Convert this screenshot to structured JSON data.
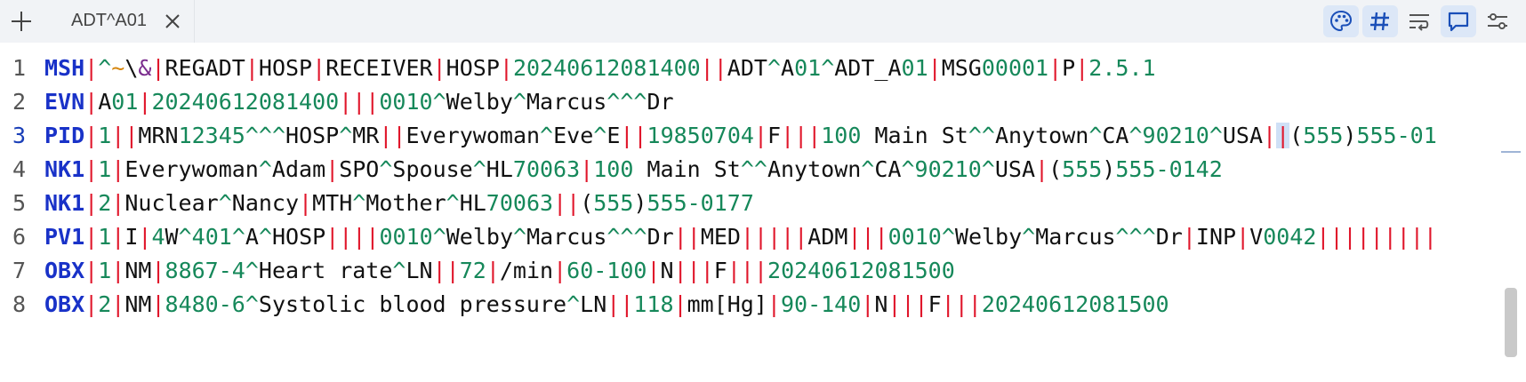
{
  "tabbar": {
    "add_icon": "plus-icon",
    "tab_title": "ADT^A01",
    "close_icon": "close-icon"
  },
  "toolbar": {
    "items": [
      {
        "icon": "palette-icon",
        "active": true
      },
      {
        "icon": "hash-icon",
        "active": true
      },
      {
        "icon": "wrap-icon",
        "active": false
      },
      {
        "icon": "comment-icon",
        "active": true
      },
      {
        "icon": "settings-sliders-icon",
        "active": false
      }
    ]
  },
  "editor": {
    "current_line": 3,
    "lines": [
      {
        "n": "1",
        "text": "MSH|^~\\&|REGADT|HOSP|RECEIVER|HOSP|20240612081400||ADT^A01^ADT_A01|MSG00001|P|2.5.1"
      },
      {
        "n": "2",
        "text": "EVN|A01|20240612081400|||0010^Welby^Marcus^^^Dr"
      },
      {
        "n": "3",
        "text": "PID|1||MRN12345^^^HOSP^MR||Everywoman^Eve^E||19850704|F|||100 Main St^^Anytown^CA^90210^USA||(555)555-01"
      },
      {
        "n": "4",
        "text": "NK1|1|Everywoman^Adam|SPO^Spouse^HL70063|100 Main St^^Anytown^CA^90210^USA|(555)555-0142"
      },
      {
        "n": "5",
        "text": "NK1|2|Nuclear^Nancy|MTH^Mother^HL70063||(555)555-0177"
      },
      {
        "n": "6",
        "text": "PV1|1|I|4W^401^A^HOSP||||0010^Welby^Marcus^^^Dr||MED|||||ADM|||0010^Welby^Marcus^^^Dr|INP|V0042|||||||||"
      },
      {
        "n": "7",
        "text": "OBX|1|NM|8867-4^Heart rate^LN||72|/min|60-100|N|||F|||20240612081500"
      },
      {
        "n": "8",
        "text": "OBX|2|NM|8480-6^Systolic blood pressure^LN||118|mm[Hg]|90-140|N|||F|||20240612081500"
      }
    ]
  },
  "colors": {
    "segment": "#1932c8",
    "field_separator": "#e0162b",
    "component_separator": "#16885a",
    "numeric": "#16885a",
    "escape": "#7b2d8e",
    "subcomponent": "#d6860c",
    "selection": "#cfe0f6"
  }
}
